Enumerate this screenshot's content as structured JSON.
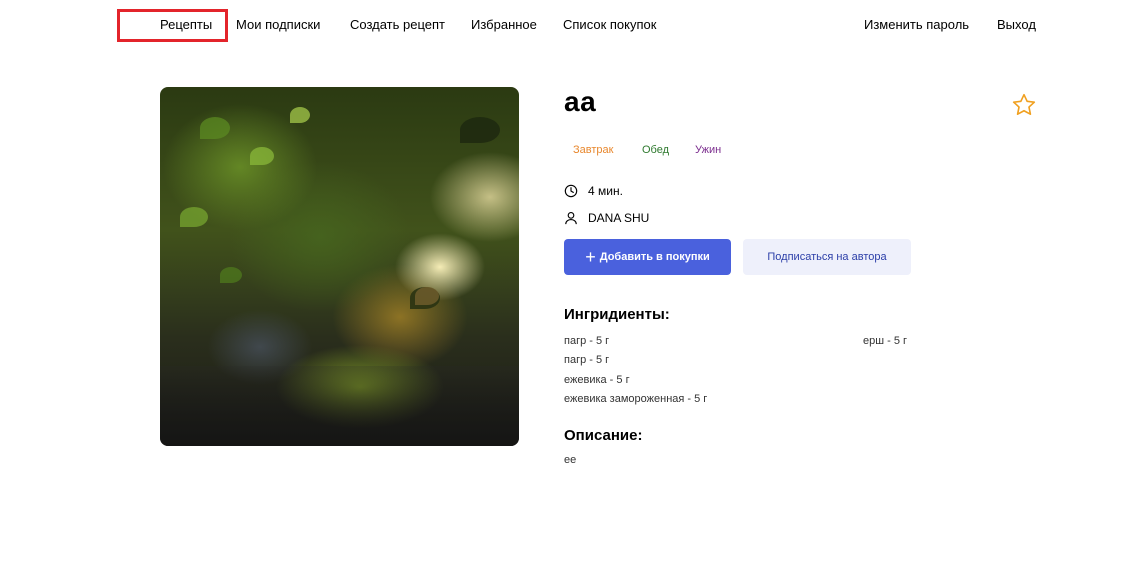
{
  "nav": {
    "left": [
      "Рецепты",
      "Мои подписки",
      "Создать рецепт",
      "Избранное",
      "Список покупок"
    ],
    "right": [
      "Изменить пароль",
      "Выход"
    ],
    "active": "Рецепты"
  },
  "recipe": {
    "title": "аа",
    "tags": [
      {
        "label": "Завтрак",
        "color": "#e8882e"
      },
      {
        "label": "Обед",
        "color": "#2f7a2f"
      },
      {
        "label": "Ужин",
        "color": "#7b2d8e"
      }
    ],
    "time": "4 мин.",
    "author": "DANA SHU",
    "add_to_cart_label": "Добавить в покупки",
    "subscribe_label": "Подписаться на автора",
    "ingredients_title": "Ингридиенты:",
    "ingredients": [
      "пагр - 5 г",
      "пагр - 5 г",
      "ежевика - 5 г",
      "ежевика замороженная - 5 г",
      "ерш - 5 г"
    ],
    "description_title": "Описание:",
    "description": "ее"
  },
  "icons": {
    "favorite": "star-outline-icon",
    "time": "clock-icon",
    "author": "user-icon",
    "add": "plus-icon"
  },
  "colors": {
    "accent": "#4a61dd",
    "star": "#f0a020",
    "active_highlight": "#e3242b"
  }
}
